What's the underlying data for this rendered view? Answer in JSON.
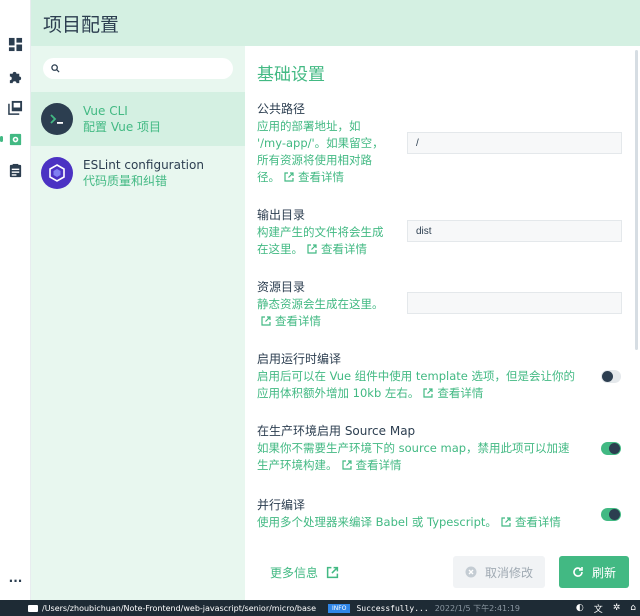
{
  "header": {
    "title": "项目配置"
  },
  "sidebar_rail": {
    "items": [
      {
        "icon": "dashboard-icon"
      },
      {
        "icon": "plugins-icon"
      },
      {
        "icon": "dependencies-icon"
      },
      {
        "icon": "configuration-icon",
        "active": true
      },
      {
        "icon": "tasks-icon"
      }
    ],
    "more_label": "..."
  },
  "config_list": {
    "search": {
      "placeholder": "",
      "value": ""
    },
    "items": [
      {
        "name": "Vue CLI",
        "description": "配置 Vue 项目",
        "icon": "vue-cli-logo",
        "selected": true
      },
      {
        "name": "ESLint configuration",
        "description": "代码质量和纠错",
        "icon": "eslint-logo",
        "selected": false
      }
    ]
  },
  "settings": {
    "title": "基础设置",
    "more_link": "查看详情",
    "items": [
      {
        "label": "公共路径",
        "description": "应用的部署地址，如 '/my-app/'。如果留空，所有资源将使用相对路径。",
        "type": "input",
        "value": "/"
      },
      {
        "label": "输出目录",
        "description": "构建产生的文件将会生成在这里。",
        "type": "input",
        "value": "dist"
      },
      {
        "label": "资源目录",
        "description": "静态资源会生成在这里。",
        "type": "input",
        "value": ""
      },
      {
        "label": "启用运行时编译",
        "description": "启用后可以在 Vue 组件中使用 template 选项，但是会让你的应用体积额外增加 10kb 左右。",
        "type": "toggle",
        "value": false
      },
      {
        "label": "在生产环境启用 Source Map",
        "description": "如果你不需要生产环境下的 source map，禁用此项可以加速生产环境构建。",
        "type": "toggle",
        "value": true
      },
      {
        "label": "并行编译",
        "description": "使用多个处理器来编译 Babel 或 Typescript。",
        "type": "toggle",
        "value": true
      }
    ]
  },
  "footer": {
    "more_info": "更多信息",
    "cancel_label": "取消修改",
    "refresh_label": "刷新"
  },
  "statusbar": {
    "path": "/Users/zhoubichuan/Note-Frontend/web-javascript/senior/micro/base",
    "badge": "INFO",
    "message": "Successfully...",
    "time": "2022/1/5 下午2:41:19"
  },
  "colors": {
    "accent": "#42b983",
    "header_bg": "#d4f0e2",
    "list_bg": "#e8f7ef",
    "text": "#2c3e50",
    "statusbar_bg": "#1e2b35"
  }
}
